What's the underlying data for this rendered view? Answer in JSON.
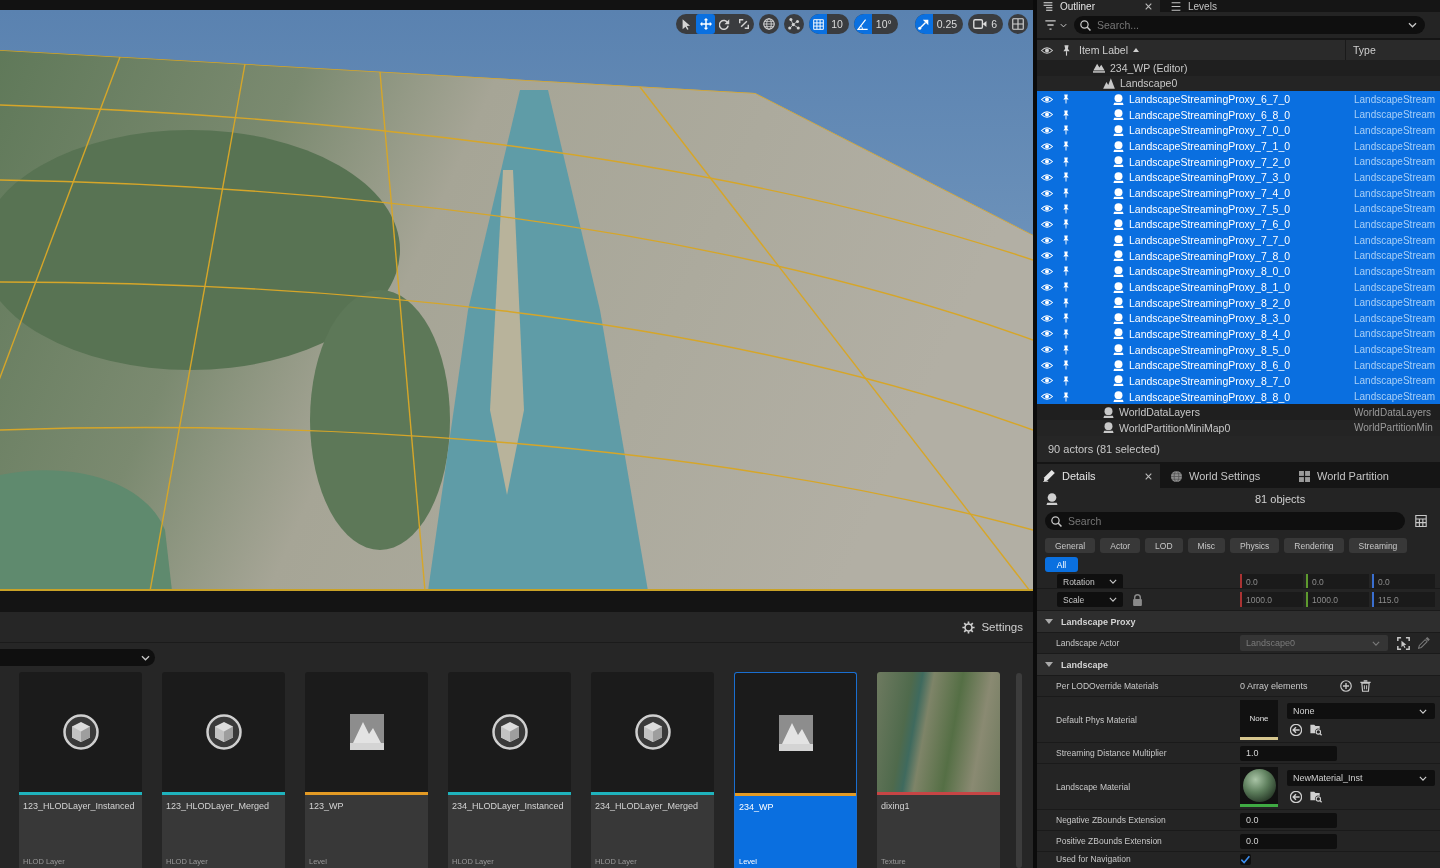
{
  "viewport": {
    "toolbar": {
      "transform_tools": [
        {
          "kind": "select",
          "selected": false
        },
        {
          "kind": "translate",
          "selected": true
        },
        {
          "kind": "rotate",
          "selected": false
        },
        {
          "kind": "scale",
          "selected": false
        }
      ],
      "snaps": [
        {
          "kind": "grid",
          "on": true,
          "value": "10"
        },
        {
          "kind": "angle",
          "on": true,
          "value": "10°"
        },
        {
          "kind": "scale",
          "on": true,
          "value": "0.25"
        }
      ],
      "camera_speed": "6"
    }
  },
  "content_browser": {
    "settings": "Settings",
    "assets": [
      {
        "name": "123_HLODLayer_Instanced",
        "type": "HLOD Layer",
        "kind": "hlod",
        "color": "#1fb3bd",
        "selected": false
      },
      {
        "name": "123_HLODLayer_Merged",
        "type": "HLOD Layer",
        "kind": "hlod",
        "color": "#1fb3bd",
        "selected": false
      },
      {
        "name": "123_WP",
        "type": "Level",
        "kind": "level",
        "color": "#e39a24",
        "selected": false
      },
      {
        "name": "234_HLODLayer_Instanced",
        "type": "HLOD Layer",
        "kind": "hlod",
        "color": "#1fb3bd",
        "selected": false
      },
      {
        "name": "234_HLODLayer_Merged",
        "type": "HLOD Layer",
        "kind": "hlod",
        "color": "#1fb3bd",
        "selected": false
      },
      {
        "name": "234_WP",
        "type": "Level",
        "kind": "level",
        "color": "#e39a24",
        "selected": true
      },
      {
        "name": "dixing1",
        "type": "Texture",
        "kind": "texture",
        "color": "#c64545",
        "selected": false
      }
    ]
  },
  "outliner": {
    "tabs": [
      {
        "label": "Outliner",
        "selected": true
      },
      {
        "label": "Levels",
        "selected": false
      }
    ],
    "search": {
      "placeholder": "Search..."
    },
    "columns": [
      {
        "label": "Item Label",
        "sorted": true
      },
      {
        "label": "Type",
        "sorted": false
      }
    ],
    "tree": [
      {
        "label": "234_WP (Editor)",
        "kind": "level",
        "selected": false,
        "children": [
          {
            "label": "Landscape0",
            "kind": "landscape",
            "selected": false,
            "children": [
              {
                "label": "LandscapeStreamingProxy_6_7_0",
                "type": "LandscapeStream",
                "kind": "actor",
                "selected": true
              },
              {
                "label": "LandscapeStreamingProxy_6_8_0",
                "type": "LandscapeStream",
                "kind": "actor",
                "selected": true
              },
              {
                "label": "LandscapeStreamingProxy_7_0_0",
                "type": "LandscapeStream",
                "kind": "actor",
                "selected": true
              },
              {
                "label": "LandscapeStreamingProxy_7_1_0",
                "type": "LandscapeStream",
                "kind": "actor",
                "selected": true
              },
              {
                "label": "LandscapeStreamingProxy_7_2_0",
                "type": "LandscapeStream",
                "kind": "actor",
                "selected": true
              },
              {
                "label": "LandscapeStreamingProxy_7_3_0",
                "type": "LandscapeStream",
                "kind": "actor",
                "selected": true
              },
              {
                "label": "LandscapeStreamingProxy_7_4_0",
                "type": "LandscapeStream",
                "kind": "actor",
                "selected": true
              },
              {
                "label": "LandscapeStreamingProxy_7_5_0",
                "type": "LandscapeStream",
                "kind": "actor",
                "selected": true
              },
              {
                "label": "LandscapeStreamingProxy_7_6_0",
                "type": "LandscapeStream",
                "kind": "actor",
                "selected": true
              },
              {
                "label": "LandscapeStreamingProxy_7_7_0",
                "type": "LandscapeStream",
                "kind": "actor",
                "selected": true
              },
              {
                "label": "LandscapeStreamingProxy_7_8_0",
                "type": "LandscapeStream",
                "kind": "actor",
                "selected": true
              },
              {
                "label": "LandscapeStreamingProxy_8_0_0",
                "type": "LandscapeStream",
                "kind": "actor",
                "selected": true
              },
              {
                "label": "LandscapeStreamingProxy_8_1_0",
                "type": "LandscapeStream",
                "kind": "actor",
                "selected": true
              },
              {
                "label": "LandscapeStreamingProxy_8_2_0",
                "type": "LandscapeStream",
                "kind": "actor",
                "selected": true
              },
              {
                "label": "LandscapeStreamingProxy_8_3_0",
                "type": "LandscapeStream",
                "kind": "actor",
                "selected": true
              },
              {
                "label": "LandscapeStreamingProxy_8_4_0",
                "type": "LandscapeStream",
                "kind": "actor",
                "selected": true
              },
              {
                "label": "LandscapeStreamingProxy_8_5_0",
                "type": "LandscapeStream",
                "kind": "actor",
                "selected": true
              },
              {
                "label": "LandscapeStreamingProxy_8_6_0",
                "type": "LandscapeStream",
                "kind": "actor",
                "selected": true
              },
              {
                "label": "LandscapeStreamingProxy_8_7_0",
                "type": "LandscapeStream",
                "kind": "actor",
                "selected": true
              },
              {
                "label": "LandscapeStreamingProxy_8_8_0",
                "type": "LandscapeStream",
                "kind": "actor",
                "selected": true
              }
            ]
          },
          {
            "label": "WorldDataLayers",
            "type": "WorldDataLayers",
            "kind": "actor",
            "selected": false
          },
          {
            "label": "WorldPartitionMiniMap0",
            "type": "WorldPartitionMin",
            "kind": "actor",
            "selected": false
          }
        ]
      }
    ],
    "status": "90 actors (81 selected)"
  },
  "details": {
    "tabs": [
      {
        "label": "Details",
        "selected": true
      },
      {
        "label": "World Settings",
        "selected": false
      },
      {
        "label": "World Partition",
        "selected": false
      }
    ],
    "object_count": "81 objects",
    "search": {
      "placeholder": "Search"
    },
    "filters": [
      {
        "label": "General",
        "selected": false
      },
      {
        "label": "Actor",
        "selected": false
      },
      {
        "label": "LOD",
        "selected": false
      },
      {
        "label": "Misc",
        "selected": false
      },
      {
        "label": "Physics",
        "selected": false
      },
      {
        "label": "Rendering",
        "selected": false
      },
      {
        "label": "Streaming",
        "selected": false
      },
      {
        "label": "All",
        "selected": true
      }
    ],
    "transform": [
      {
        "label": "Rotation",
        "kind": "rotation",
        "values": [
          "0.0",
          "0.0",
          "0.0"
        ]
      },
      {
        "label": "Scale",
        "kind": "scale",
        "values": [
          "1000.0",
          "1000.0",
          "115.0"
        ]
      }
    ],
    "sections": [
      {
        "title": "Landscape Proxy",
        "expanded": true,
        "properties": [
          {
            "label": "Landscape Actor",
            "kind": "actor_picker",
            "value": "Landscape0",
            "disabled": true
          }
        ]
      },
      {
        "title": "Landscape",
        "expanded": true,
        "properties": [
          {
            "label": "Per LODOverride Materials",
            "kind": "array",
            "value": "0 Array elements",
            "disabled": false
          },
          {
            "label": "Default Phys Material",
            "kind": "asset",
            "value": "None",
            "thumbnail": {
              "kind": "text",
              "label": "None"
            },
            "color": "#d6c68e",
            "disabled": false
          },
          {
            "label": "Streaming Distance Multiplier",
            "kind": "number",
            "value": "1.0",
            "disabled": false
          },
          {
            "label": "Landscape Material",
            "kind": "asset",
            "value": "NewMaterial_Inst",
            "thumbnail": {
              "kind": "sphere"
            },
            "color": "#3faa43",
            "disabled": false
          },
          {
            "label": "Negative ZBounds Extension",
            "kind": "number",
            "value": "0.0",
            "disabled": false
          },
          {
            "label": "Positive ZBounds Extension",
            "kind": "number",
            "value": "0.0",
            "disabled": false
          },
          {
            "label": "Used for Navigation",
            "kind": "checkbox",
            "checked": true,
            "disabled": false
          }
        ]
      }
    ]
  }
}
